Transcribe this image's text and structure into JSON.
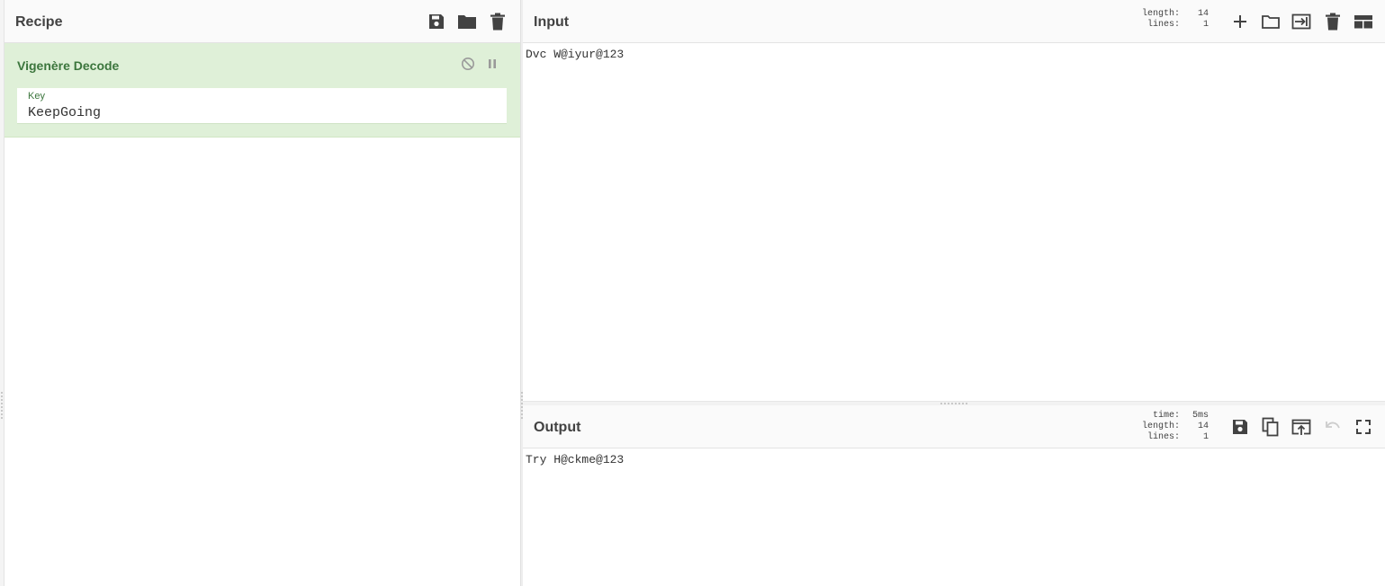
{
  "recipe": {
    "title": "Recipe",
    "toolbar_icons": [
      "save-icon",
      "folder-icon",
      "trash-icon"
    ],
    "operations": [
      {
        "name": "Vigenère Decode",
        "controls": [
          "disable-icon",
          "pause-icon"
        ],
        "args": [
          {
            "label": "Key",
            "value": "KeepGoing"
          }
        ]
      }
    ]
  },
  "input": {
    "title": "Input",
    "stats": {
      "length_label": "length:",
      "length": "14",
      "lines_label": "lines:",
      "lines": "1"
    },
    "toolbar_icons": [
      "plus-icon",
      "folder-icon",
      "import-icon",
      "trash-icon",
      "layout-icon"
    ],
    "text": "Dvc W@iyur@123"
  },
  "output": {
    "title": "Output",
    "stats": {
      "time_label": "time:",
      "time": "5ms",
      "length_label": "length:",
      "length": "14",
      "lines_label": "lines:",
      "lines": "1"
    },
    "toolbar_icons": [
      "save-icon",
      "copy-icon",
      "replace-input-icon",
      "undo-icon",
      "fullscreen-icon"
    ],
    "text": "Try H@ckme@123"
  },
  "colors": {
    "operation_bg": "#dff0d8",
    "operation_text": "#3c763d",
    "icon": "#424242",
    "icon_disabled": "#cccccc"
  }
}
